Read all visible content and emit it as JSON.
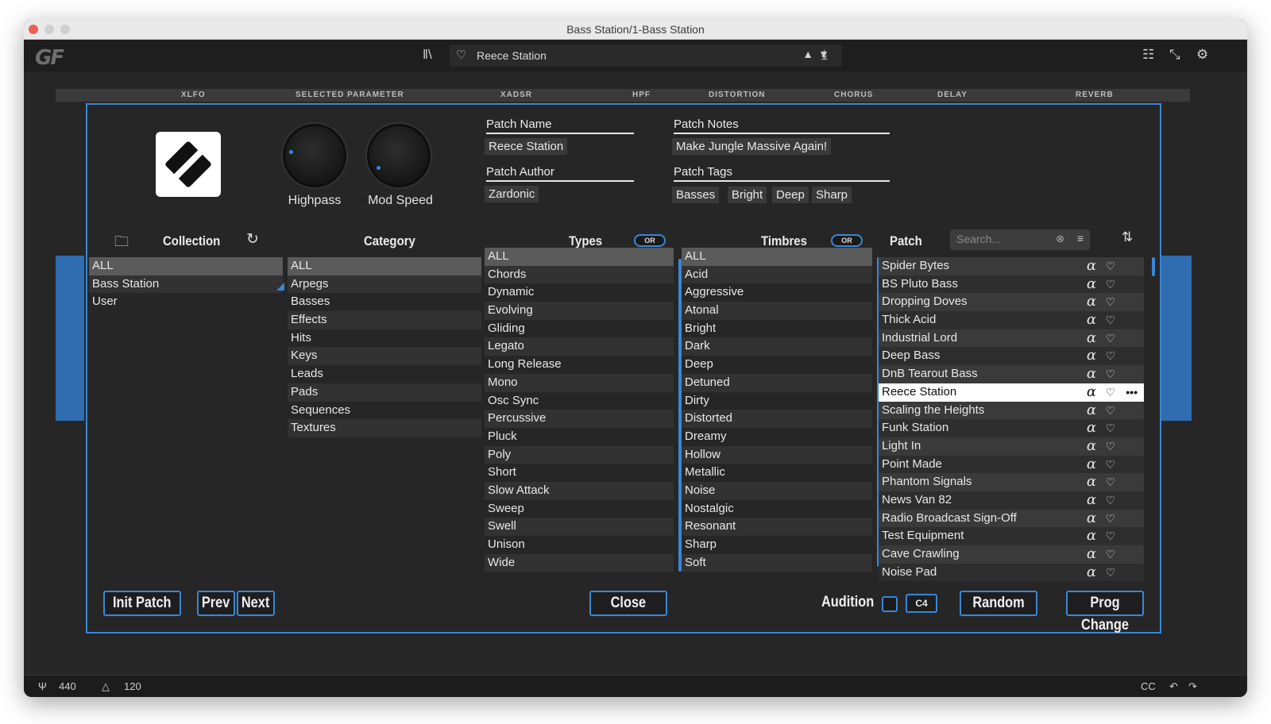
{
  "window": {
    "title": "Bass Station/1-Bass Station"
  },
  "toolbar": {
    "logo": "GF",
    "preset_name": "Reece Station"
  },
  "strip": {
    "labels": [
      "XLFO",
      "SELECTED PARAMETER",
      "XADSR",
      "HPF",
      "DISTORTION",
      "CHORUS",
      "DELAY",
      "REVERB"
    ]
  },
  "status": {
    "tuning": "440",
    "tempo": "120",
    "cc": "CC"
  },
  "knobs": [
    {
      "label": "Highpass",
      "level": 0.2
    },
    {
      "label": "Mod Speed",
      "level": 0.05
    }
  ],
  "patch_info": {
    "name_label": "Patch Name",
    "name_value": "Reece Station",
    "author_label": "Patch Author",
    "author_value": "Zardonic",
    "notes_label": "Patch Notes",
    "notes_value": "Make Jungle Massive Again!",
    "tags_label": "Patch Tags",
    "tags": [
      "Basses",
      "Bright",
      "Deep",
      "Sharp"
    ]
  },
  "headers": {
    "collection": "Collection",
    "category": "Category",
    "types": "Types",
    "timbres": "Timbres",
    "patch": "Patch",
    "types_toggle": "OR",
    "timbres_toggle": "OR",
    "search_placeholder": "Search..."
  },
  "collection": [
    "ALL",
    "Bass Station",
    "User"
  ],
  "category": [
    "ALL",
    "Arpegs",
    "Basses",
    "Effects",
    "Hits",
    "Keys",
    "Leads",
    "Pads",
    "Sequences",
    "Textures"
  ],
  "types": [
    "ALL",
    "Chords",
    "Dynamic",
    "Evolving",
    "Gliding",
    "Legato",
    "Long Release",
    "Mono",
    "Osc Sync",
    "Percussive",
    "Pluck",
    "Poly",
    "Short",
    "Slow Attack",
    "Sweep",
    "Swell",
    "Unison",
    "Wide"
  ],
  "timbres": [
    "ALL",
    "Acid",
    "Aggressive",
    "Atonal",
    "Bright",
    "Dark",
    "Deep",
    "Detuned",
    "Dirty",
    "Distorted",
    "Dreamy",
    "Hollow",
    "Metallic",
    "Noise",
    "Nostalgic",
    "Resonant",
    "Sharp",
    "Soft"
  ],
  "patches": [
    "Spider Bytes",
    "BS Pluto Bass",
    "Dropping Doves",
    "Thick Acid",
    "Industrial Lord",
    "Deep Bass",
    "DnB Tearout Bass",
    "Reece Station",
    "Scaling the Heights",
    "Funk Station",
    "Light In",
    "Point Made",
    "Phantom Signals",
    "News Van 82",
    "Radio Broadcast Sign-Off",
    "Test Equipment",
    "Cave Crawling",
    "Noise Pad"
  ],
  "current_patch": "Reece Station",
  "buttons": {
    "init": "Init Patch",
    "prev": "Prev",
    "next": "Next",
    "close": "Close",
    "audition": "Audition",
    "audition_note": "C4",
    "random": "Random",
    "prog_change": "Prog Change"
  }
}
